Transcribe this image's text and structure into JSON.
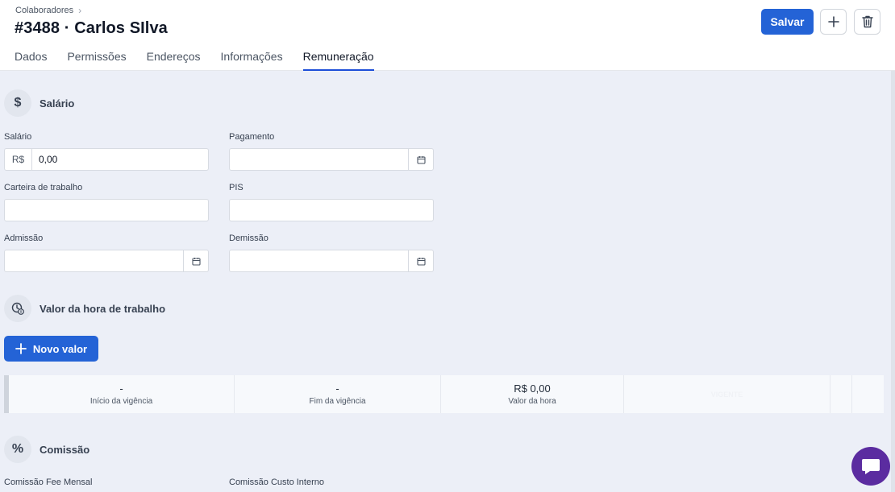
{
  "header": {
    "breadcrumb": "Colaboradores",
    "title": "#3488 · Carlos SIlva",
    "save_label": "Salvar",
    "add_icon": "plus-icon",
    "delete_icon": "trash-icon"
  },
  "tabs": [
    {
      "label": "Dados",
      "active": false
    },
    {
      "label": "Permissões",
      "active": false
    },
    {
      "label": "Endereços",
      "active": false
    },
    {
      "label": "Informações",
      "active": false
    },
    {
      "label": "Remuneração",
      "active": true
    }
  ],
  "salario_section": {
    "title": "Salário",
    "icon": "dollar-icon",
    "fields": {
      "salario": {
        "label": "Salário",
        "prefix": "R$",
        "value": "0,00"
      },
      "pagamento": {
        "label": "Pagamento",
        "value": ""
      },
      "carteira": {
        "label": "Carteira de trabalho",
        "value": ""
      },
      "pis": {
        "label": "PIS",
        "value": ""
      },
      "admissao": {
        "label": "Admissão",
        "value": ""
      },
      "demissao": {
        "label": "Demissão",
        "value": ""
      }
    }
  },
  "hora_section": {
    "title": "Valor da hora de trabalho",
    "icon": "clock-dollar-icon",
    "new_button": "Novo valor",
    "row": {
      "inicio_value": "-",
      "inicio_label": "Início da vigência",
      "fim_value": "-",
      "fim_label": "Fim da vigência",
      "valor_value": "R$ 0,00",
      "valor_label": "Valor da hora",
      "faded_text": "VIGENTE"
    }
  },
  "comissao_section": {
    "title": "Comissão",
    "icon": "percent-icon",
    "fee_label": "Comissão Fee Mensal",
    "custo_label": "Comissão Custo Interno"
  },
  "colors": {
    "primary": "#2463d6",
    "content_bg": "#eceff7",
    "chat": "#5b2ca0"
  }
}
